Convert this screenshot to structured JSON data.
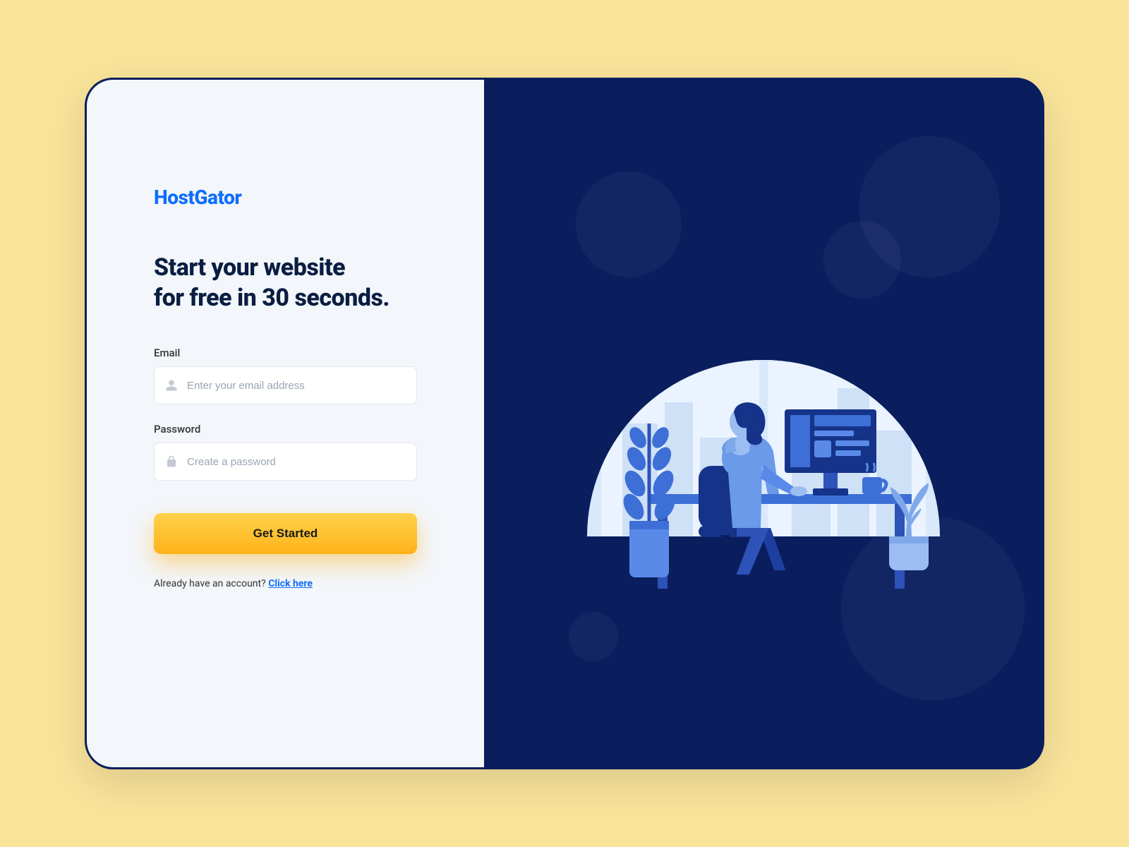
{
  "brand": "HostGator",
  "headline_line1": "Start your website",
  "headline_line2": "for free in 30 seconds.",
  "form": {
    "email_label": "Email",
    "email_placeholder": "Enter your email address",
    "email_value": "",
    "password_label": "Password",
    "password_placeholder": "Create a password",
    "password_value": "",
    "submit_label": "Get Started"
  },
  "signin": {
    "prompt": "Already have an account? ",
    "link_text": "Click here"
  },
  "colors": {
    "page_bg": "#f9e49a",
    "card_bg_dark": "#0a1e5e",
    "panel_bg": "#f3f6fa",
    "brand_blue": "#0d6efd",
    "cta_gradient_top": "#ffd24a",
    "cta_gradient_bottom": "#ffb31a"
  },
  "illustration": {
    "description": "Person working at desk with computer, plants, coffee cup, city skyline in background inside arched dome",
    "icons": [
      "person-icon",
      "computer-icon",
      "desk-icon",
      "plant-icon",
      "coffee-cup-icon"
    ]
  }
}
